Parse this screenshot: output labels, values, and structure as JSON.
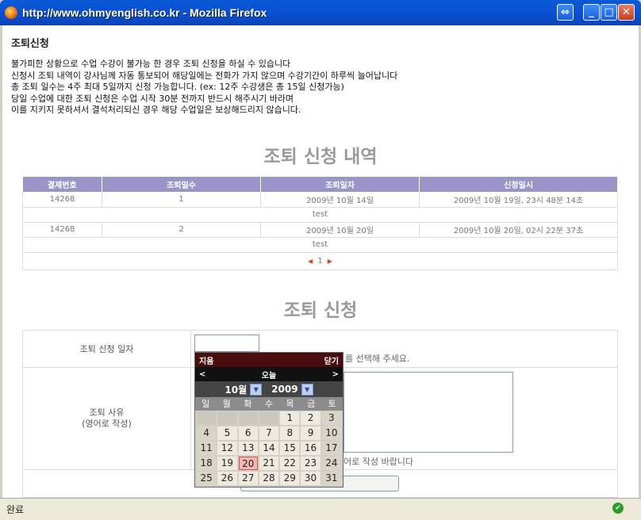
{
  "window": {
    "title": "http://www.ohmyenglish.co.kr - Mozilla Firefox"
  },
  "page": {
    "heading": "조퇴신청",
    "notices": [
      "불가피한 상황으로 수업 수강이 불가능 한 경우 조퇴 신청을 하실 수 있습니다",
      "신청시 조퇴 내역이 강사님께 자동 통보되어 해당일에는 전화가 가지 않으며 수강기간이 하루씩 늘어납니다",
      "총 조퇴 일수는 4주 최대 5일까지 신청 가능합니다. (ex: 12주 수강생은 총 15일 신청가능)",
      "당일 수업에 대한 조퇴 신청은 수업 시작 30분 전까지 반드시 해주시기 바라며",
      "이를 지키지 못하셔서 결석처리되신 경우 해당 수업일은 보상해드리지 않습니다."
    ]
  },
  "history": {
    "title": "조퇴 신청 내역",
    "columns": [
      "결제번호",
      "조퇴일수",
      "조퇴일자",
      "신청일시"
    ],
    "rows": [
      {
        "payment_no": "14268",
        "days": "1",
        "date": "2009년 10월 14일",
        "requested": "2009년 10월 19일, 23시 48분 14초",
        "note": "test"
      },
      {
        "payment_no": "14268",
        "days": "2",
        "date": "2009년 10월 20일",
        "requested": "2009년 10월 20일, 02시 22분 37초",
        "note": "test"
      }
    ],
    "page": "1"
  },
  "form": {
    "title": "조퇴 신청",
    "date_label": "조퇴 신청 일자",
    "date_value": "",
    "date_hint": "를 선택해 주세요.",
    "reason_label_1": "조퇴 사유",
    "reason_label_2": "(영어로 작성)",
    "reason_hint": "어로 작성 바랍니다",
    "submit_label": ""
  },
  "calendar": {
    "clear": "지움",
    "close": "닫기",
    "prev": "<",
    "today": "오늘",
    "next": ">",
    "month": "10월",
    "year": "2009",
    "weekdays": [
      "일",
      "월",
      "화",
      "수",
      "목",
      "금",
      "토"
    ],
    "leading_blanks": 4,
    "days_in_month": 31,
    "today_day": 20
  },
  "statusbar": {
    "text": "완료"
  }
}
